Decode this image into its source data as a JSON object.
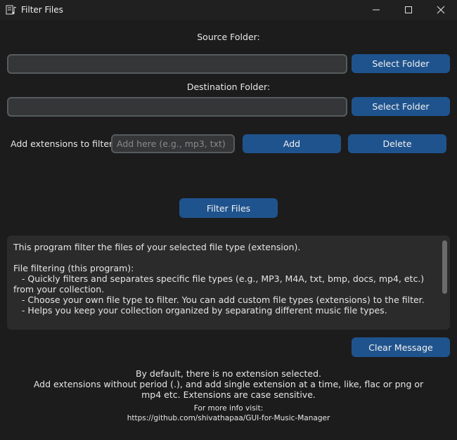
{
  "window": {
    "title": "Filter Files",
    "app_icon": "music-files-icon",
    "controls": [
      "minimize-icon",
      "maximize-icon",
      "close-icon"
    ]
  },
  "source": {
    "label": "Source Folder:",
    "value": "",
    "button": "Select Folder"
  },
  "destination": {
    "label": "Destination Folder:",
    "value": "",
    "button": "Select Folder"
  },
  "extensions": {
    "label": "Add extensions to filter:",
    "placeholder": "Add here (e.g., mp3, txt)",
    "add_button": "Add",
    "delete_button": "Delete"
  },
  "filter_button": "Filter Files",
  "message": {
    "text": "This program filter the files of your selected file type (extension).\n\nFile filtering (this program):\n   - Quickly filters and separates specific file types (e.g., MP3, M4A, txt, bmp, docs, mp4, etc.) from your collection.\n   - Choose your own file type to filter. You can add custom file types (extensions) to the filter.\n   - Helps you keep your collection organized by separating different music file types."
  },
  "clear_button": "Clear Message",
  "info": {
    "line1": "By default, there is no extension selected.",
    "line2": "Add extensions without period (.), and add single extension at a time, like, flac or png or",
    "line3": "mp4 etc. Extensions are case sensitive."
  },
  "more_info": {
    "label": "For more info visit:",
    "link": "https://github.com/shivathapaa/GUI-for-Music-Manager"
  },
  "colors": {
    "background": "#1c1c1c",
    "button": "#1f538d",
    "field": "#343638",
    "field_border": "#565b5e",
    "textbox": "#2b2b2b"
  }
}
